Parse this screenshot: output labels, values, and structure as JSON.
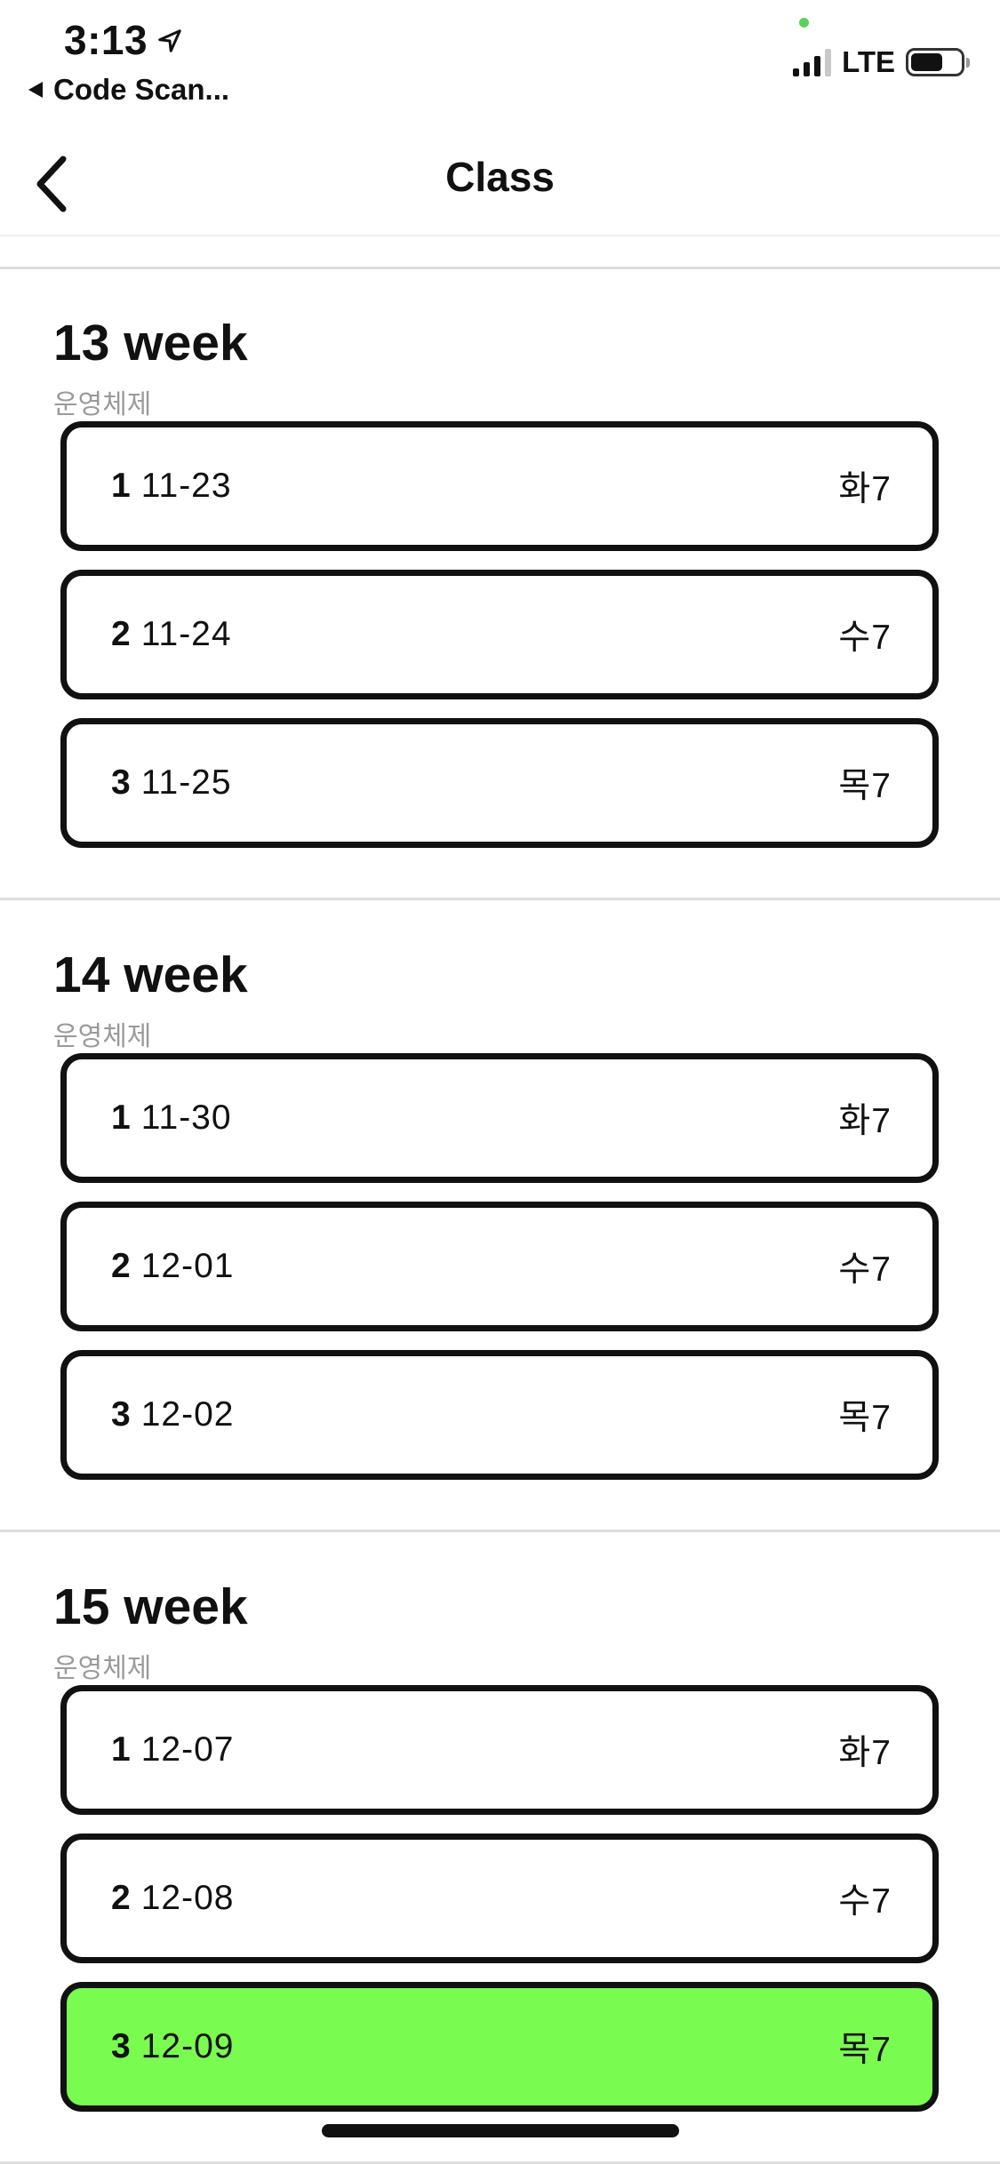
{
  "status_bar": {
    "time": "3:13",
    "back_app": "Code Scan...",
    "network": "LTE",
    "signal_bars": 3,
    "battery_level": 0.65
  },
  "nav": {
    "title": "Class"
  },
  "weeks": [
    {
      "title": "13 week",
      "subtitle": "운영체제",
      "classes": [
        {
          "num": "1",
          "date": "11-23",
          "day": "화7",
          "active": false
        },
        {
          "num": "2",
          "date": "11-24",
          "day": "수7",
          "active": false
        },
        {
          "num": "3",
          "date": "11-25",
          "day": "목7",
          "active": false
        }
      ]
    },
    {
      "title": "14 week",
      "subtitle": "운영체제",
      "classes": [
        {
          "num": "1",
          "date": "11-30",
          "day": "화7",
          "active": false
        },
        {
          "num": "2",
          "date": "12-01",
          "day": "수7",
          "active": false
        },
        {
          "num": "3",
          "date": "12-02",
          "day": "목7",
          "active": false
        }
      ]
    },
    {
      "title": "15 week",
      "subtitle": "운영체제",
      "classes": [
        {
          "num": "1",
          "date": "12-07",
          "day": "화7",
          "active": false
        },
        {
          "num": "2",
          "date": "12-08",
          "day": "수7",
          "active": false
        },
        {
          "num": "3",
          "date": "12-09",
          "day": "목7",
          "active": true
        }
      ]
    }
  ],
  "colors": {
    "active_card": "#79fb4f",
    "card_border": "#111111",
    "subtitle": "#9a9a9a",
    "divider": "#dddddd"
  }
}
